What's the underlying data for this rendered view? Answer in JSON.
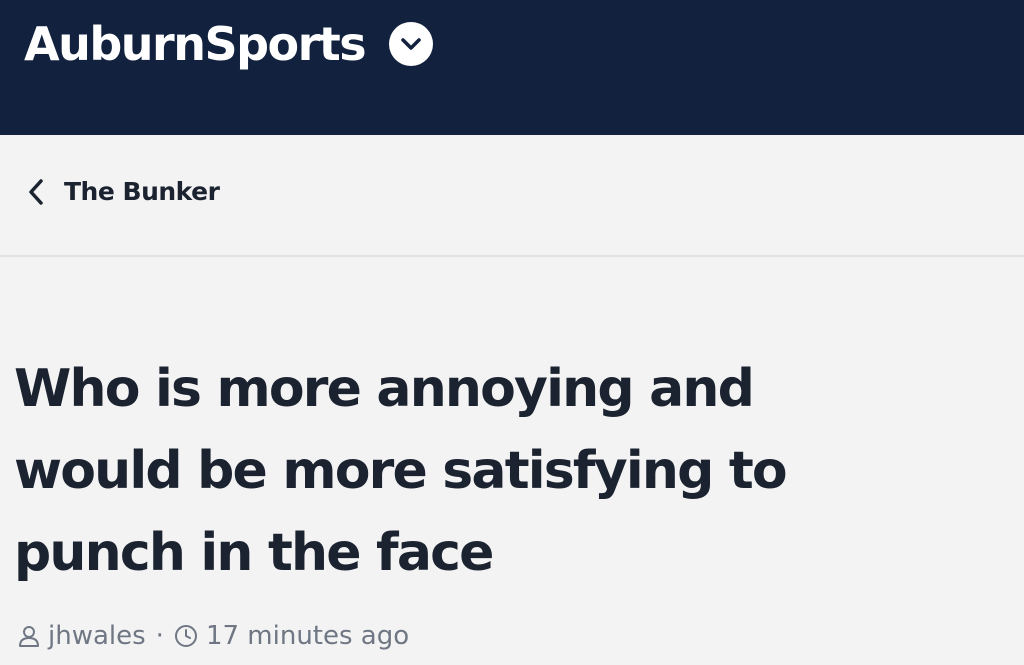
{
  "header": {
    "brand_name": "AuburnSports",
    "brand_menu_icon": "chevron-down-circle-icon",
    "background_color": "#12213d"
  },
  "breadcrumb": {
    "back_icon": "chevron-left-icon",
    "label": "The Bunker"
  },
  "thread": {
    "title_lines": [
      "Who is more annoying and",
      "would be more satisfying to",
      "punch in the face"
    ],
    "author": "jhwales",
    "separator": "·",
    "posted": "17 minutes ago",
    "author_icon": "user-icon",
    "time_icon": "clock-icon"
  },
  "colors": {
    "title_text": "#1c2330",
    "meta_text": "#707784",
    "page_background": "#f3f3f3"
  }
}
